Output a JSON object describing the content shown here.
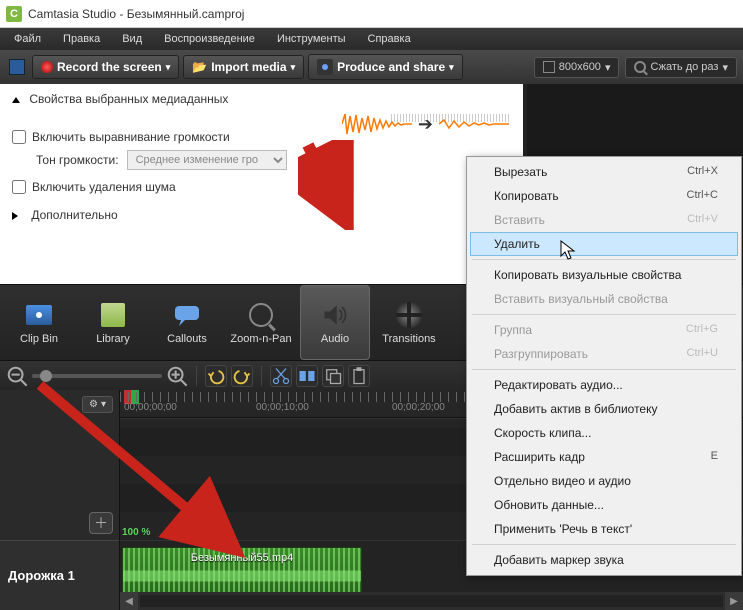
{
  "window": {
    "app_name": "Camtasia Studio",
    "file_name": "Безымянный.camproj"
  },
  "menu": {
    "file": "Файл",
    "edit": "Правка",
    "view": "Вид",
    "play": "Воспроизведение",
    "tools": "Инструменты",
    "help": "Справка"
  },
  "toolbar": {
    "record": "Record the screen",
    "import": "Import media",
    "produce": "Produce and share",
    "dimensions": "800x600",
    "zoom": "Сжать до раз"
  },
  "props": {
    "title": "Свойства выбранных медиаданных",
    "enable_leveling": "Включить выравнивание громкости",
    "tone_label": "Тон громкости:",
    "tone_option": "Среднее изменение гро",
    "enable_noise": "Включить удаления шума",
    "advanced": "Дополнительно"
  },
  "tabs": {
    "clipbin": "Clip Bin",
    "library": "Library",
    "callouts": "Callouts",
    "zoompan": "Zoom-n-Pan",
    "audio": "Audio",
    "transitions": "Transitions"
  },
  "timeline": {
    "track1": "Дорожка 1",
    "zoom_pct": "100 %",
    "clip_name": "Безымянный55.mp4",
    "t0": "00;00;00;00",
    "t1": "00;00;10;00",
    "t2": "00;00;20;00"
  },
  "context_menu": {
    "cut": {
      "label": "Вырезать",
      "key": "Ctrl+X"
    },
    "copy": {
      "label": "Копировать",
      "key": "Ctrl+C"
    },
    "paste": {
      "label": "Вставить",
      "key": "Ctrl+V"
    },
    "delete": {
      "label": "Удалить",
      "key": ""
    },
    "copy_vis": {
      "label": "Копировать визуальные свойства",
      "key": ""
    },
    "paste_vis": {
      "label": "Вставить визуальный свойства",
      "key": ""
    },
    "group": {
      "label": "Группа",
      "key": "Ctrl+G"
    },
    "ungroup": {
      "label": "Разгруппировать",
      "key": "Ctrl+U"
    },
    "edit_audio": {
      "label": "Редактировать аудио...",
      "key": ""
    },
    "add_asset": {
      "label": "Добавить актив в библиотеку",
      "key": ""
    },
    "clip_speed": {
      "label": "Скорость клипа...",
      "key": ""
    },
    "extend_frame": {
      "label": "Расширить кадр",
      "key": "E"
    },
    "separate": {
      "label": "Отдельно видео и аудио",
      "key": ""
    },
    "update": {
      "label": "Обновить данные...",
      "key": ""
    },
    "speech": {
      "label": "Применить 'Речь в текст'",
      "key": ""
    },
    "add_marker": {
      "label": "Добавить маркер звука",
      "key": ""
    }
  }
}
